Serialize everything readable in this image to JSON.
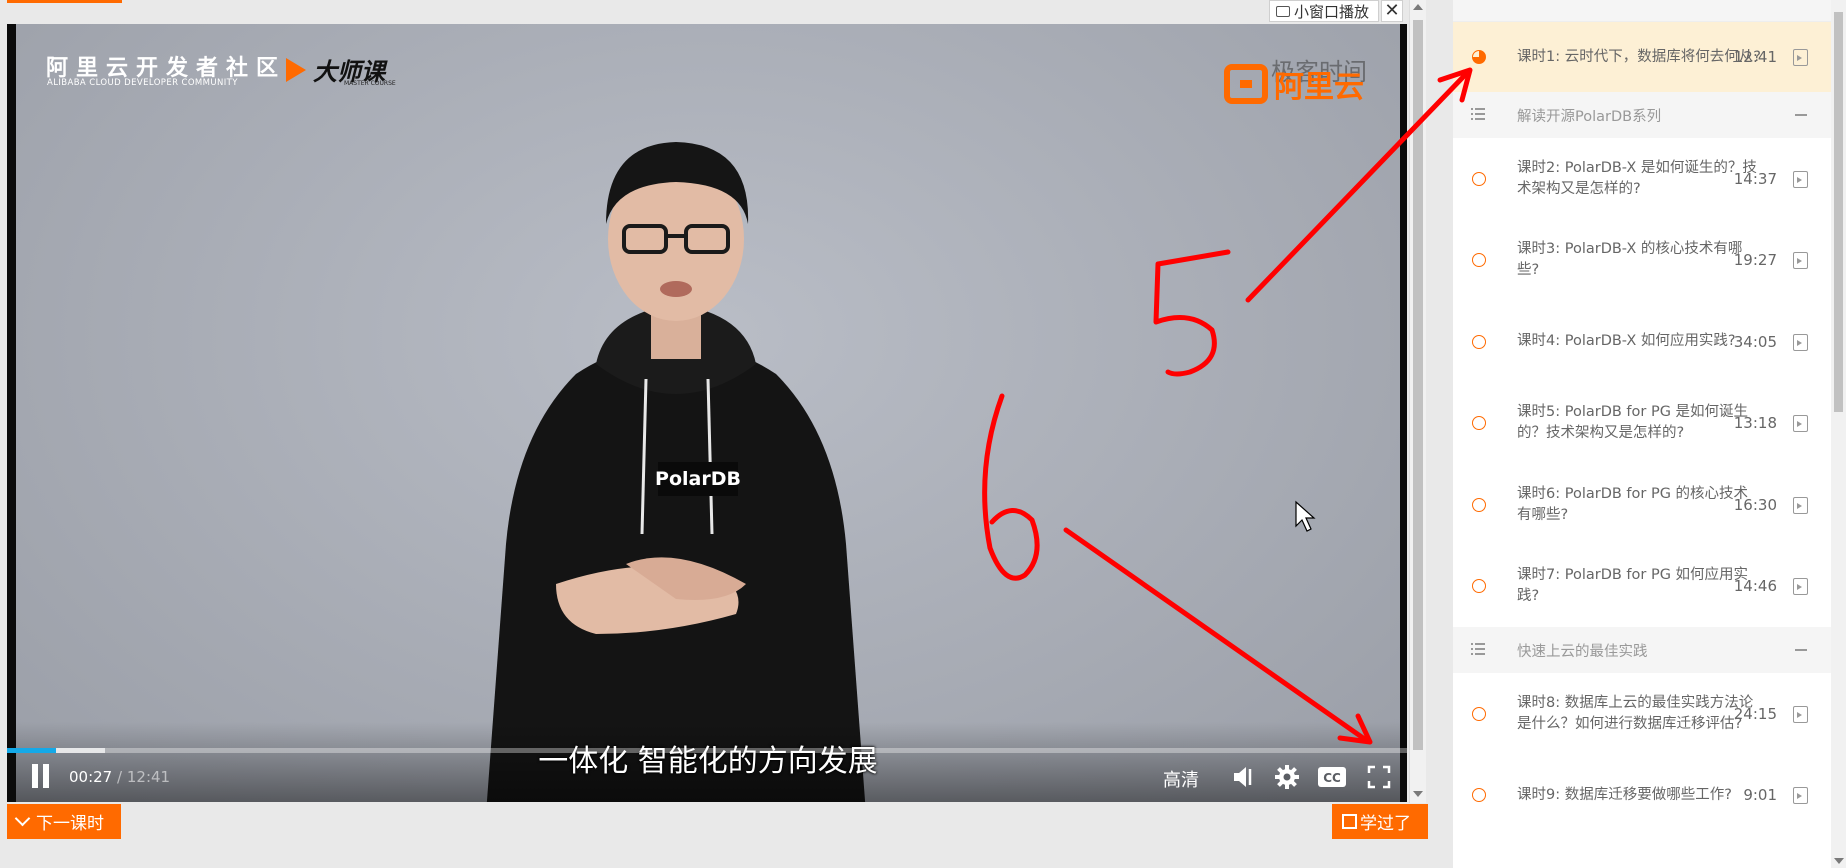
{
  "mini_window": {
    "label": "小窗口播放",
    "close": "✕"
  },
  "player": {
    "logo_cn": "阿里云开发者社区",
    "logo_en": "ALIBABA CLOUD DEVELOPER COMMUNITY",
    "master_course": "大师课",
    "master_course_en": "MASTER COURSE",
    "brand": "阿里云",
    "partner": "极客时间",
    "shirt_text": "PolarDB",
    "subtitle": "一体化 智能化的方向发展",
    "current_time": "00:27",
    "separator": "/",
    "total_time": "12:41",
    "progress_played": 0.035,
    "progress_buffered": 0.07,
    "quality": "高清"
  },
  "buttons": {
    "next_lesson": "下一课时",
    "learned": "学过了"
  },
  "sidebar": {
    "items": [
      {
        "type": "lesson",
        "title": "课时1: 云时代下，数据库将何去何从?",
        "duration": "12:41",
        "state": "in-progress"
      },
      {
        "type": "section",
        "title": "解读开源PolarDB系列"
      },
      {
        "type": "lesson",
        "title": "课时2: PolarDB-X 是如何诞生的？技术架构又是怎样的?",
        "duration": "14:37",
        "state": "not-started"
      },
      {
        "type": "lesson",
        "title": "课时3: PolarDB-X 的核心技术有哪些?",
        "duration": "19:27",
        "state": "not-started"
      },
      {
        "type": "lesson",
        "title": "课时4: PolarDB-X 如何应用实践?",
        "duration": "34:05",
        "state": "not-started"
      },
      {
        "type": "lesson",
        "title": "课时5: PolarDB for PG 是如何诞生的？技术架构又是怎样的?",
        "duration": "13:18",
        "state": "not-started"
      },
      {
        "type": "lesson",
        "title": "课时6: PolarDB for PG 的核心技术有哪些?",
        "duration": "16:30",
        "state": "not-started"
      },
      {
        "type": "lesson",
        "title": "课时7: PolarDB for PG 如何应用实践?",
        "duration": "14:46",
        "state": "not-started"
      },
      {
        "type": "section",
        "title": "快速上云的最佳实践"
      },
      {
        "type": "lesson",
        "title": "课时8: 数据库上云的最佳实践方法论是什么？如何进行数据库迁移评估?",
        "duration": "24:15",
        "state": "not-started"
      },
      {
        "type": "lesson",
        "title": "课时9: 数据库迁移要做哪些工作?",
        "duration": "9:01",
        "state": "not-started"
      }
    ]
  },
  "annotations": {
    "mark_5": "5",
    "mark_6": "6",
    "color": "#ff0000"
  },
  "colors": {
    "accent": "#ff6a00",
    "progress": "#14a9e8",
    "active_row": "#fdf0d5"
  }
}
